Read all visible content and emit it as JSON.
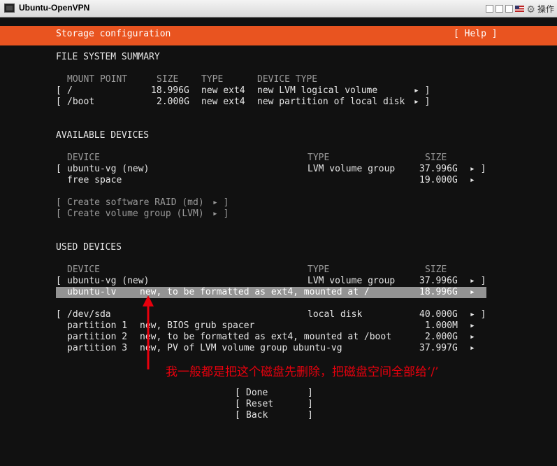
{
  "window": {
    "title": "Ubuntu-OpenVPN",
    "ops_label": "操作"
  },
  "header": {
    "title": "Storage configuration",
    "help": "[ Help ]"
  },
  "fs_summary": {
    "heading": "FILE SYSTEM SUMMARY",
    "columns": [
      "MOUNT POINT",
      "SIZE",
      "TYPE",
      "DEVICE TYPE"
    ],
    "rows": [
      {
        "mount": "/",
        "size": "18.996G",
        "type": "new ext4",
        "device_type": "new LVM logical volume"
      },
      {
        "mount": "/boot",
        "size": "2.000G",
        "type": "new ext4",
        "device_type": "new partition of local disk"
      }
    ]
  },
  "available": {
    "heading": "AVAILABLE DEVICES",
    "columns": [
      "DEVICE",
      "TYPE",
      "SIZE"
    ],
    "rows": [
      {
        "device": "ubuntu-vg (new)",
        "type": "LVM volume group",
        "size": "37.996G"
      },
      {
        "device": "free space",
        "type": "",
        "size": "19.000G"
      }
    ],
    "actions": [
      "Create software RAID (md)",
      "Create volume group (LVM)"
    ]
  },
  "used": {
    "heading": "USED DEVICES",
    "columns": [
      "DEVICE",
      "TYPE",
      "SIZE"
    ],
    "vg": {
      "device": "ubuntu-vg (new)",
      "type": "LVM volume group",
      "size": "37.996G"
    },
    "lv": {
      "device": "ubuntu-lv",
      "desc": "new, to be formatted as ext4, mounted at /",
      "size": "18.996G"
    },
    "disk": {
      "device": "/dev/sda",
      "type": "local disk",
      "size": "40.000G"
    },
    "partitions": [
      {
        "name": "partition 1",
        "desc": "new, BIOS grub spacer",
        "size": "1.000M"
      },
      {
        "name": "partition 2",
        "desc": "new, to be formatted as ext4, mounted at /boot",
        "size": "2.000G"
      },
      {
        "name": "partition 3",
        "desc": "new, PV of LVM volume group ubuntu-vg",
        "size": "37.997G"
      }
    ]
  },
  "buttons": {
    "done": "Done",
    "reset": "Reset",
    "back": "Back"
  },
  "annotation": "我一般都是把这个磁盘先删除，把磁盘空间全部给‘/’",
  "colors": {
    "accent": "#e95420",
    "background": "#111111",
    "selected": "#939393",
    "annotation": "#e8000d"
  }
}
